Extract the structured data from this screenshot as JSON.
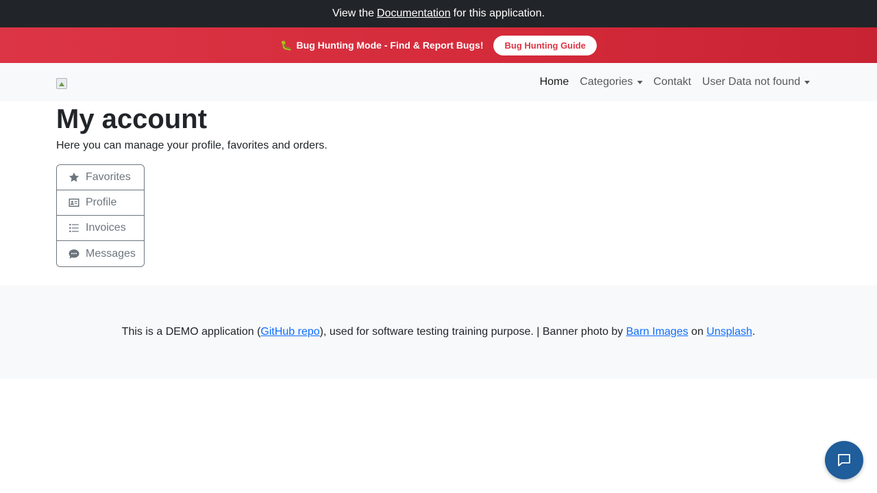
{
  "doc_banner": {
    "prefix": "View the",
    "link": "Documentation",
    "suffix": "for this application."
  },
  "bug_banner": {
    "emoji": "🐛",
    "text": "Bug Hunting Mode - Find & Report Bugs!",
    "button": "Bug Hunting Guide"
  },
  "navbar": {
    "items": [
      {
        "label": "Home"
      },
      {
        "label": "Categories"
      },
      {
        "label": "Contakt"
      },
      {
        "label": "User Data not found"
      }
    ]
  },
  "page": {
    "title": "My account",
    "lead": "Here you can manage your profile, favorites and orders."
  },
  "account_menu": [
    {
      "label": "Favorites",
      "icon": "star-icon"
    },
    {
      "label": "Profile",
      "icon": "id-card-icon"
    },
    {
      "label": "Invoices",
      "icon": "list-icon"
    },
    {
      "label": "Messages",
      "icon": "comment-dots-icon"
    }
  ],
  "footer": {
    "t1": "This is a DEMO application (",
    "link1": "GitHub repo",
    "t2": "), used for software testing training purpose. | Banner photo by ",
    "link2": "Barn Images",
    "t3": " on ",
    "link3": "Unsplash",
    "t4": "."
  },
  "colors": {
    "top_bar": "#212529",
    "bug_banner": "#dc3545",
    "link": "#0d6efd",
    "chat_button": "#1f5d9b"
  }
}
